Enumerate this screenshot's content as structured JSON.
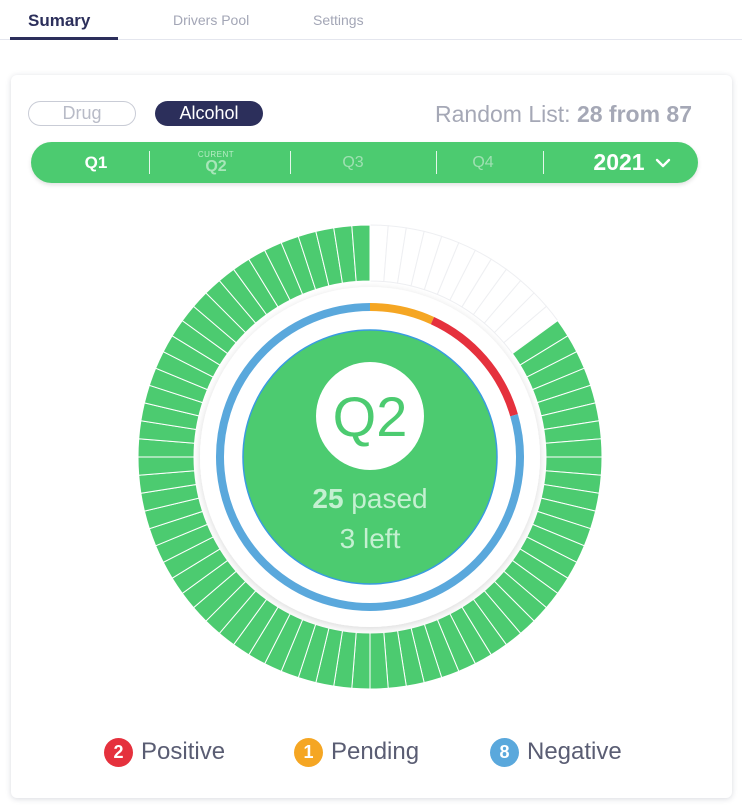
{
  "tabs": [
    {
      "label": "Sumary",
      "active": true
    },
    {
      "label": "Drivers  Pool",
      "active": false
    },
    {
      "label": "Settings",
      "active": false
    }
  ],
  "type_toggle": {
    "drug": "Drug",
    "alcohol": "Alcohol",
    "selected": "Alcohol"
  },
  "random_list": {
    "label": "Random List:",
    "value": "28 from 87"
  },
  "quarters": {
    "items": [
      {
        "label": "Q1",
        "state": "past"
      },
      {
        "label": "Q2",
        "state": "current",
        "tag": "CURENT"
      },
      {
        "label": "Q3",
        "state": "future"
      },
      {
        "label": "Q4",
        "state": "future"
      }
    ],
    "year": "2021",
    "year_icon": "chevron-down-icon"
  },
  "summary": {
    "quarter": "Q2",
    "passed_number": "25",
    "passed_word": " pased",
    "left_text": "3 left",
    "total_slots": 28,
    "filled_slots": 25,
    "results": {
      "positive": 2,
      "pending": 1,
      "negative": 8
    }
  },
  "legend": [
    {
      "count": "2",
      "label": "Positive",
      "color": "#e5313d"
    },
    {
      "count": "1",
      "label": "Pending",
      "color": "#f5a623"
    },
    {
      "count": "8",
      "label": "Negative",
      "color": "#5aa8dc"
    }
  ],
  "colors": {
    "primary": "#2c2f5b",
    "green": "#4ccb70",
    "positive": "#e5313d",
    "pending": "#f5a623",
    "negative": "#5aa8dc"
  }
}
